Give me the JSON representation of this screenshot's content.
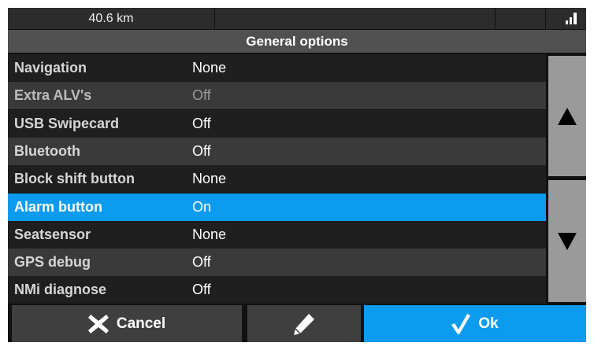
{
  "statusbar": {
    "distance": "40.6 km",
    "signal_icon": "signal-bars-icon"
  },
  "title": "General options",
  "options": [
    {
      "label": "Navigation",
      "value": "None",
      "state": "normal"
    },
    {
      "label": "Extra ALV's",
      "value": "Off",
      "state": "dim"
    },
    {
      "label": "USB Swipecard",
      "value": "Off",
      "state": "normal"
    },
    {
      "label": "Bluetooth",
      "value": "Off",
      "state": "normal"
    },
    {
      "label": "Block shift button",
      "value": "None",
      "state": "normal"
    },
    {
      "label": "Alarm button",
      "value": "On",
      "state": "selected"
    },
    {
      "label": "Seatsensor",
      "value": "None",
      "state": "normal"
    },
    {
      "label": "GPS debug",
      "value": "Off",
      "state": "normal"
    },
    {
      "label": "NMi diagnose",
      "value": "Off",
      "state": "normal"
    }
  ],
  "buttons": {
    "cancel_label": "Cancel",
    "ok_label": "Ok"
  },
  "colors": {
    "accent": "#0d9bf0",
    "row_dark": "#1f1f1f",
    "row_light": "#3a3a3a"
  }
}
